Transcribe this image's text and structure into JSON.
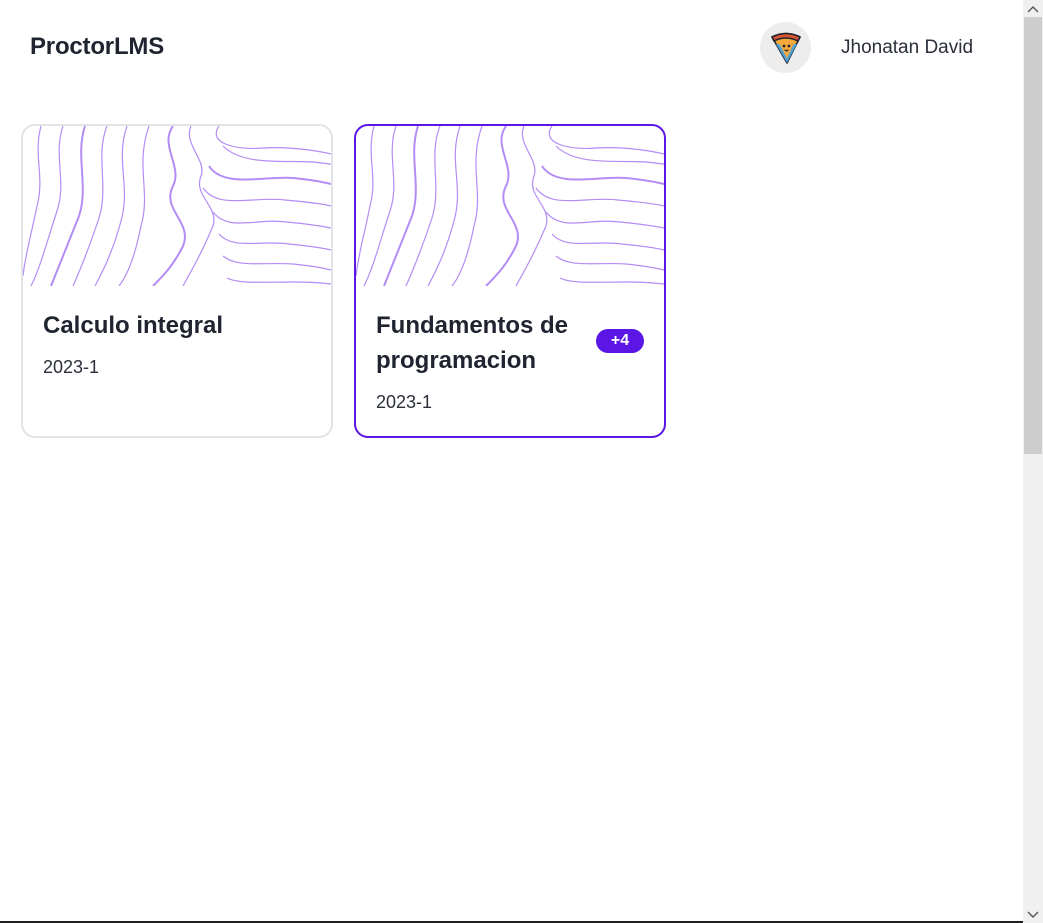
{
  "header": {
    "brand": "ProctorLMS",
    "user": {
      "name": "Jhonatan David",
      "avatar_icon": "pizza-slice-icon"
    }
  },
  "courses": [
    {
      "title": "Calculo integral",
      "term": "2023-1",
      "badge": "",
      "selected": false
    },
    {
      "title": "Fundamentos de programacion",
      "term": "2023-1",
      "badge": "+4",
      "selected": true
    }
  ],
  "colors": {
    "accent": "#5b16e6",
    "banner_lines": "#b48cf5",
    "card_border": "#e3e3e6"
  },
  "scrollbar": {
    "up_icon": "scroll-up-arrow-icon",
    "down_icon": "scroll-down-arrow-icon"
  }
}
